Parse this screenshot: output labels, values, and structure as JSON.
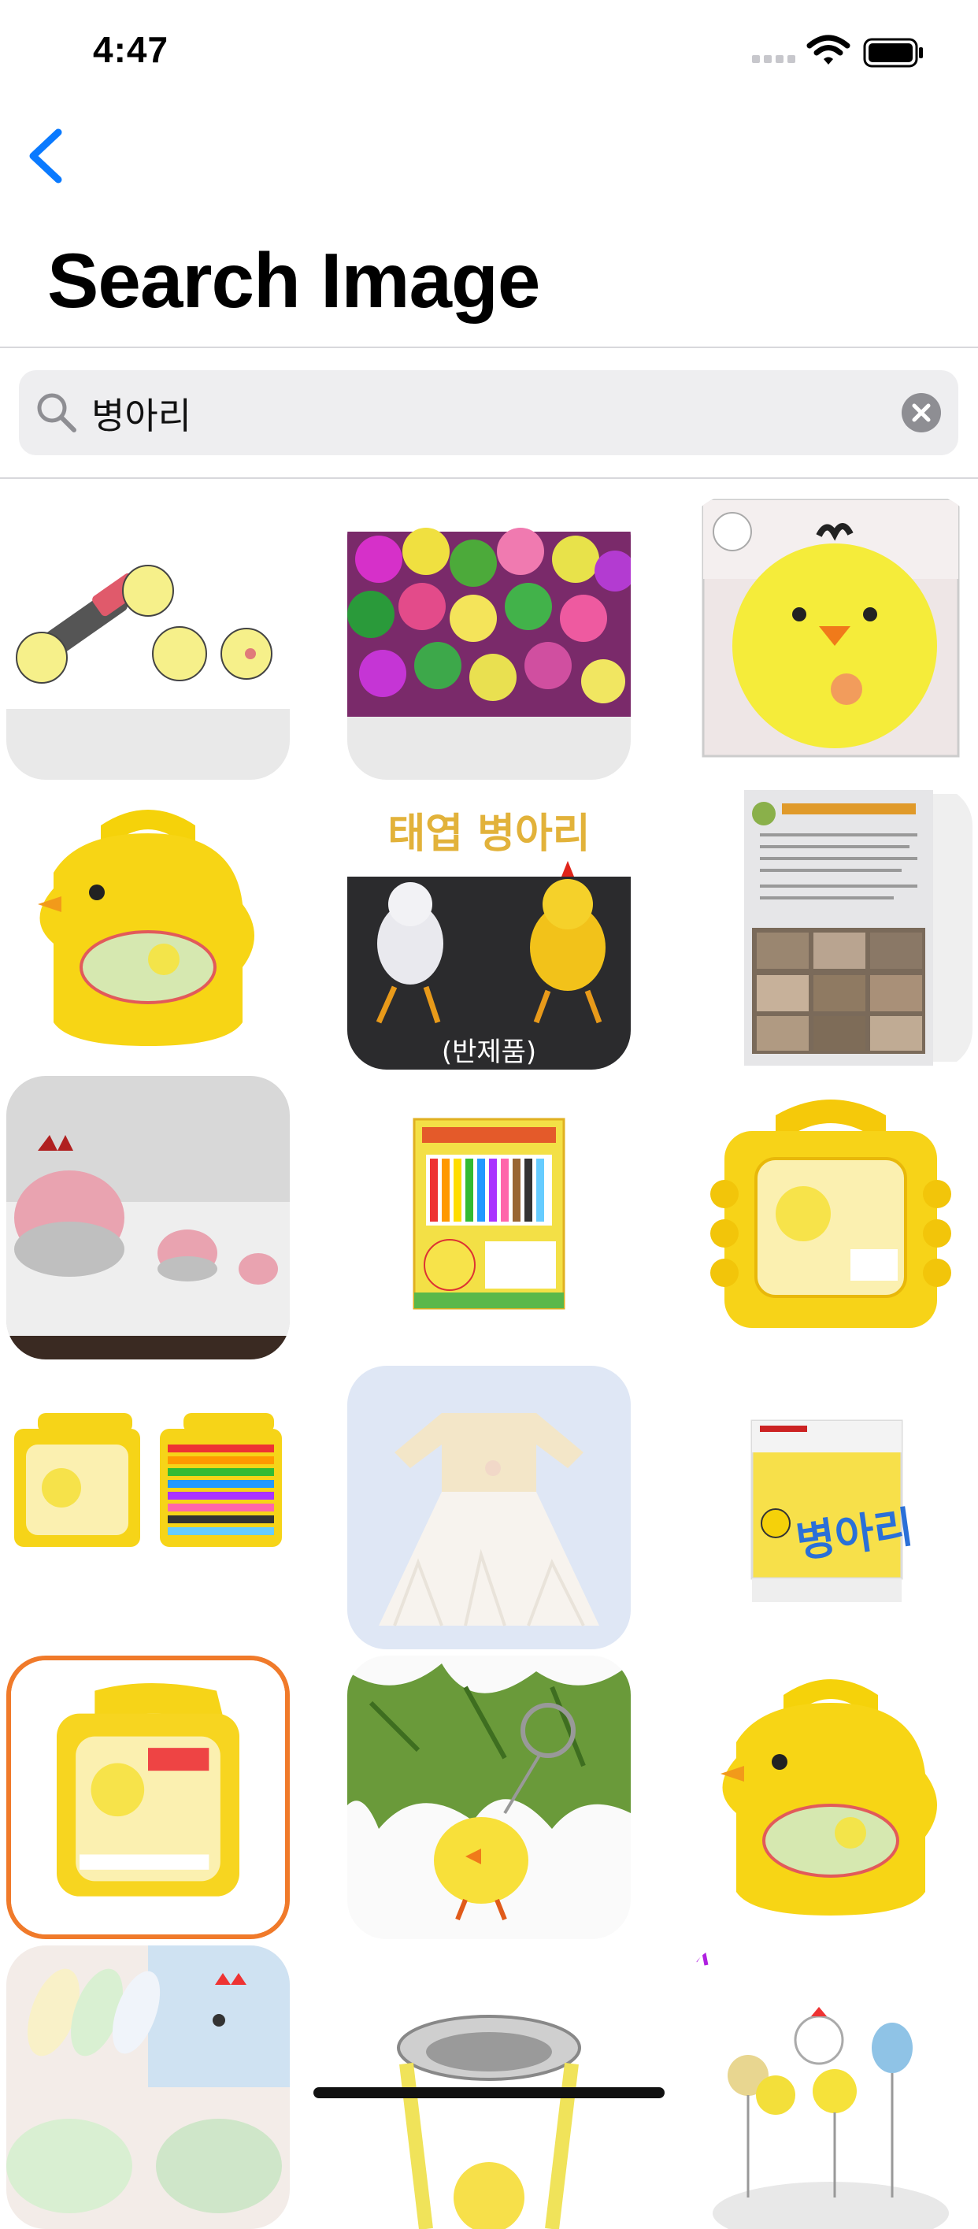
{
  "status": {
    "time": "4:47"
  },
  "nav": {
    "title": "Search Image"
  },
  "search": {
    "query": "병아리",
    "placeholder": ""
  },
  "images": [
    {
      "subject": "chicks with lipstick illustration"
    },
    {
      "subject": "colorful dyed chicks"
    },
    {
      "subject": "yellow chick plush toy"
    },
    {
      "subject": "yellow chick shaped case"
    },
    {
      "subject": "wind-up chick toys",
      "caption": "태엽 병아리",
      "sub_caption": "(반제품)"
    },
    {
      "subject": "chick farm flyer"
    },
    {
      "subject": "ceramic hen figurines"
    },
    {
      "subject": "chick crayon box"
    },
    {
      "subject": "yellow chick lunch case"
    },
    {
      "subject": "yellow chick crayon cases"
    },
    {
      "subject": "cream baby dress"
    },
    {
      "subject": "chick sticker pack",
      "caption": "병아리"
    },
    {
      "subject": "yellow chick case orange border"
    },
    {
      "subject": "fluffy chick keychain"
    },
    {
      "subject": "yellow chick shaped case"
    },
    {
      "subject": "chick socks"
    },
    {
      "subject": "chick pet bowl"
    },
    {
      "subject": "chick cake toppers"
    }
  ]
}
